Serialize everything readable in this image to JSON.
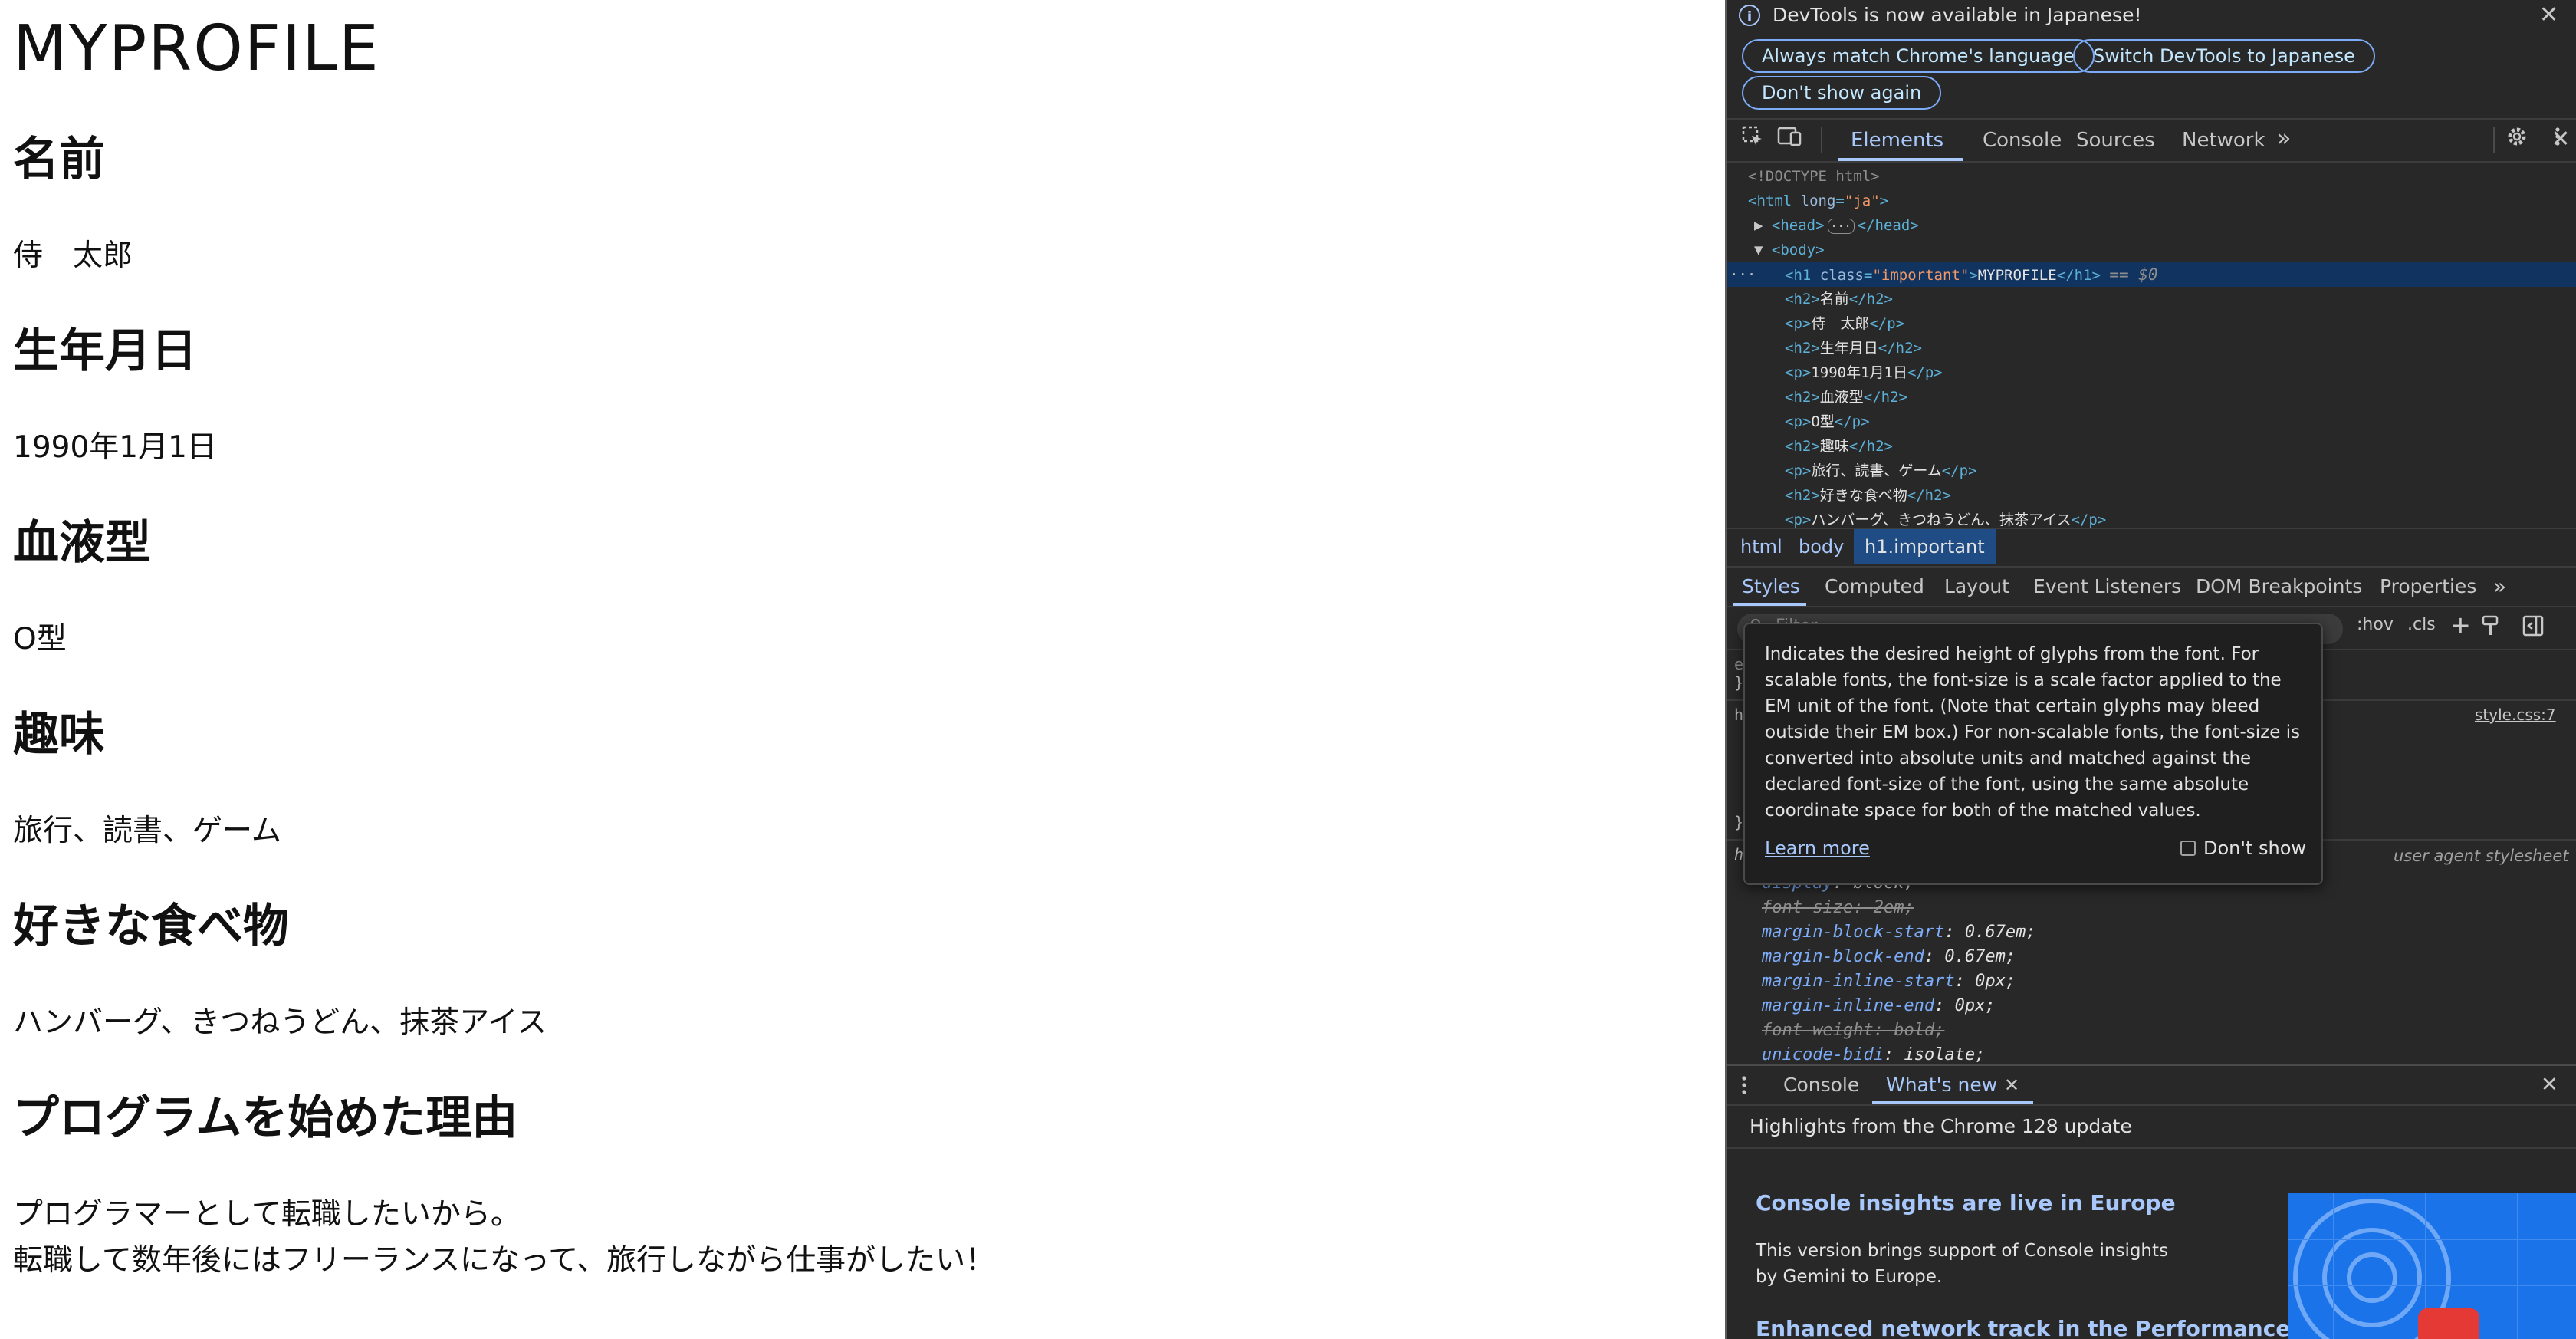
{
  "page": {
    "title": "MYPROFILE",
    "sections": [
      {
        "heading": "名前",
        "body": [
          "侍　太郎"
        ]
      },
      {
        "heading": "生年月日",
        "body": [
          "1990年1月1日"
        ]
      },
      {
        "heading": "血液型",
        "body": [
          "O型"
        ]
      },
      {
        "heading": "趣味",
        "body": [
          "旅行、読書、ゲーム"
        ]
      },
      {
        "heading": "好きな食べ物",
        "body": [
          "ハンバーグ、きつねうどん、抹茶アイス"
        ]
      },
      {
        "heading": "プログラムを始めた理由",
        "body": [
          "プログラマーとして転職したいから。",
          "転職して数年後にはフリーランスになって、旅行しながら仕事がしたい！"
        ]
      }
    ]
  },
  "devtools": {
    "banner": {
      "icon": "info-icon",
      "message": "DevTools is now available in Japanese!",
      "buttons": [
        "Always match Chrome's language",
        "Switch DevTools to Japanese",
        "Don't show again"
      ],
      "close": "✕"
    },
    "toolbar": {
      "tabs": [
        "Elements",
        "Console",
        "Sources",
        "Network"
      ],
      "more": "»",
      "inspect_icon": "inspect-element-icon",
      "device_icon": "device-toolbar-icon",
      "settings_icon": "gear-icon",
      "menu_icon": "kebab-menu-icon",
      "close_icon": "close-icon"
    },
    "dom": {
      "doctype": "<!DOCTYPE html>",
      "html_open_tag": "<html",
      "html_attr": "long",
      "html_attr_value": "\"ja\"",
      "head_open": "<head>",
      "head_ellipsis": "···",
      "head_close": "</head>",
      "body_open": "<body>",
      "selected_line": {
        "tag_open": "<h1",
        "attr": "class",
        "value": "\"important\"",
        "text": "MYPROFILE",
        "tag_close": "</h1>",
        "marker": "== $0"
      },
      "children": [
        {
          "open": "<h2>",
          "text": "名前",
          "close": "</h2>"
        },
        {
          "open": "<p>",
          "text": "侍　太郎",
          "close": "</p>"
        },
        {
          "open": "<h2>",
          "text": "生年月日",
          "close": "</h2>"
        },
        {
          "open": "<p>",
          "text": "1990年1月1日",
          "close": "</p>"
        },
        {
          "open": "<h2>",
          "text": "血液型",
          "close": "</h2>"
        },
        {
          "open": "<p>",
          "text": "O型",
          "close": "</p>"
        },
        {
          "open": "<h2>",
          "text": "趣味",
          "close": "</h2>"
        },
        {
          "open": "<p>",
          "text": "旅行、読書、ゲーム",
          "close": "</p>"
        },
        {
          "open": "<h2>",
          "text": "好きな食べ物",
          "close": "</h2>"
        },
        {
          "open": "<p>",
          "text": "ハンバーグ、きつねうどん、抹茶アイス",
          "close": "</p>"
        }
      ]
    },
    "breadcrumbs": [
      "html",
      "body",
      "h1.important"
    ],
    "styles_tabs": [
      "Styles",
      "Computed",
      "Layout",
      "Event Listeners",
      "DOM Breakpoints",
      "Properties"
    ],
    "styles_more": "»",
    "filter": {
      "placeholder": "Filter",
      "hov": ":hov",
      "cls": ".cls"
    },
    "tooltip": {
      "text": "Indicates the desired height of glyphs from the font. For scalable fonts, the font-size is a scale factor applied to the EM unit of the font. (Note that certain glyphs may bleed outside their EM box.) For non-scalable fonts, the font-size is converted into absolute units and matched against the declared font-size of the font, using the same absolute coordinate space for both of the matched values.",
      "learn_more": "Learn more",
      "dont_show": "Don't show"
    },
    "rules": {
      "source": "style.css:7",
      "ua_label": "user agent stylesheet",
      "ua_props": [
        {
          "name": "display",
          "value": "block;",
          "overridden": false
        },
        {
          "name": "font-size",
          "value": "2em;",
          "overridden": true
        },
        {
          "name": "margin-block-start",
          "value": "0.67em;",
          "overridden": false
        },
        {
          "name": "margin-block-end",
          "value": "0.67em;",
          "overridden": false
        },
        {
          "name": "margin-inline-start",
          "value": "0px;",
          "overridden": false
        },
        {
          "name": "margin-inline-end",
          "value": "0px;",
          "overridden": false
        },
        {
          "name": "font-weight",
          "value": "bold;",
          "overridden": true
        },
        {
          "name": "unicode-bidi",
          "value": "isolate;",
          "overridden": false
        }
      ]
    },
    "drawer": {
      "tabs": [
        "Console",
        "What's new"
      ],
      "whats_new_close": "✕",
      "close": "✕",
      "highlight": "Highlights from the Chrome 128 update",
      "items": [
        {
          "title": "Console insights are live in Europe",
          "body": "This version brings support of Console insights by Gemini to Europe."
        },
        {
          "title": "Enhanced network track in the Performance",
          "body": ""
        }
      ]
    }
  }
}
